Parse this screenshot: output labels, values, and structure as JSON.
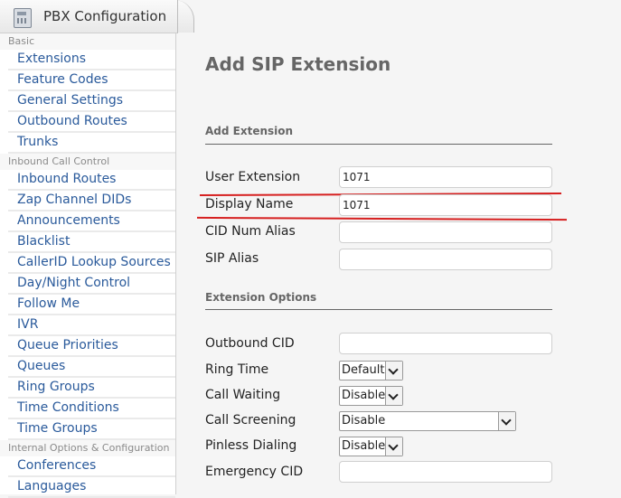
{
  "window": {
    "tab_title": "PBX Configuration"
  },
  "sidebar": {
    "sections": [
      {
        "title": "Basic",
        "items": [
          "Extensions",
          "Feature Codes",
          "General Settings",
          "Outbound Routes",
          "Trunks"
        ]
      },
      {
        "title": "Inbound Call Control",
        "items": [
          "Inbound Routes",
          "Zap Channel DIDs",
          "Announcements",
          "Blacklist",
          "CallerID Lookup Sources",
          "Day/Night Control",
          "Follow Me",
          "IVR",
          "Queue Priorities",
          "Queues",
          "Ring Groups",
          "Time Conditions",
          "Time Groups"
        ]
      },
      {
        "title": "Internal Options & Configuration",
        "items": [
          "Conferences",
          "Languages"
        ]
      }
    ]
  },
  "main": {
    "title": "Add SIP Extension",
    "add_extension": {
      "heading": "Add Extension",
      "user_extension_label": "User Extension",
      "user_extension_value": "1071",
      "display_name_label": "Display Name",
      "display_name_value": "1071",
      "cid_num_alias_label": "CID Num Alias",
      "cid_num_alias_value": "",
      "sip_alias_label": "SIP Alias",
      "sip_alias_value": ""
    },
    "extension_options": {
      "heading": "Extension Options",
      "outbound_cid_label": "Outbound CID",
      "outbound_cid_value": "",
      "ring_time_label": "Ring Time",
      "ring_time_value": "Default",
      "call_waiting_label": "Call Waiting",
      "call_waiting_value": "Disable",
      "call_screening_label": "Call Screening",
      "call_screening_value": "Disable",
      "pinless_dialing_label": "Pinless Dialing",
      "pinless_dialing_value": "Disable",
      "emergency_cid_label": "Emergency CID",
      "emergency_cid_value": ""
    }
  },
  "colors": {
    "link": "#2a5a9b",
    "highlight": "#d62020"
  }
}
